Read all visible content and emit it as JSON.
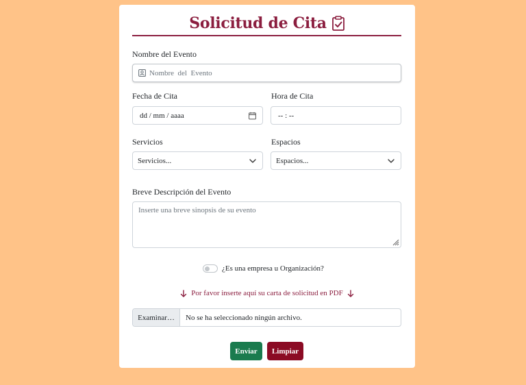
{
  "form": {
    "title": "Solicitud de Cita",
    "event_name_label": "Nombre del Evento",
    "event_name_placeholder": "Nombre  del  Evento",
    "date_label": "Fecha de Cita",
    "date_value": "dd / mm / aaaa",
    "time_label": "Hora de Cita",
    "time_value": "-- : --",
    "services_label": "Servicios",
    "services_selected": "Servicios...",
    "spaces_label": "Espacios",
    "spaces_selected": "Espacios...",
    "description_label": "Breve Descripción del Evento",
    "description_placeholder": "Inserte una breve sinopsis de su evento",
    "company_toggle_label": "¿Es una empresa u Organización?",
    "pdf_note": "Por favor inserte aquí su carta de solicitud en PDF",
    "file_button": "Examinar…",
    "file_status": "No se ha seleccionado ningún archivo.",
    "send_button": "Enviar",
    "clear_button": "Limpiar"
  },
  "colors": {
    "background": "#FFC388",
    "brand": "#8B1E3F",
    "send": "#1A7B4E",
    "clear": "#8B0B24"
  },
  "icons": [
    "clipboard-check-icon",
    "person-badge-icon",
    "calendar-icon",
    "chevron-down-icon",
    "arrow-down-icon"
  ]
}
